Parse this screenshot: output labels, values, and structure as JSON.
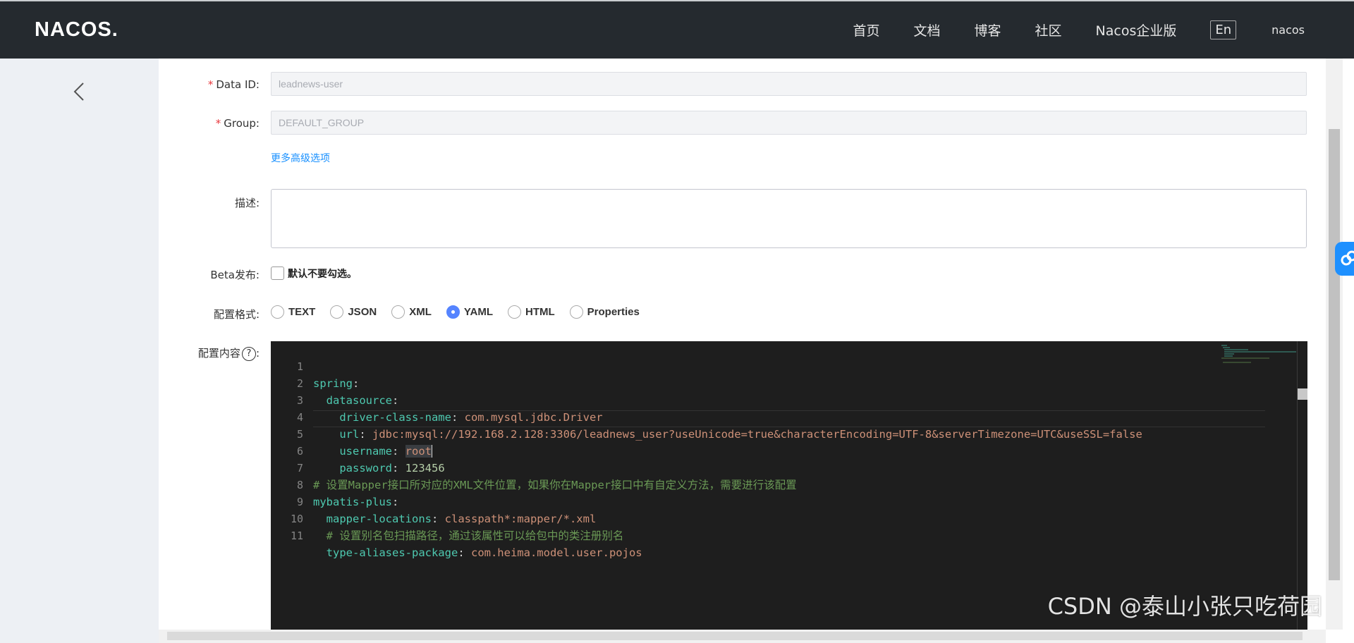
{
  "header": {
    "logo": "NACOS.",
    "nav": [
      "首页",
      "文档",
      "博客",
      "社区",
      "Nacos企业版"
    ],
    "lang": "En",
    "user": "nacos"
  },
  "form": {
    "data_id": {
      "label": "Data ID:",
      "value": "leadnews-user"
    },
    "group": {
      "label": "Group:",
      "value": "DEFAULT_GROUP"
    },
    "advanced_link": "更多高级选项",
    "description": {
      "label": "描述:",
      "value": ""
    },
    "beta": {
      "label": "Beta发布:",
      "checkbox_text": "默认不要勾选。",
      "checked": false
    },
    "format": {
      "label": "配置格式:",
      "options": [
        "TEXT",
        "JSON",
        "XML",
        "YAML",
        "HTML",
        "Properties"
      ],
      "selected": "YAML"
    },
    "content": {
      "label": "配置内容",
      "help": "?"
    }
  },
  "editor": {
    "lines": [
      {
        "num": "1",
        "text": "spring:"
      },
      {
        "num": "2",
        "text": "  datasource:"
      },
      {
        "num": "3",
        "text": "    driver-class-name: com.mysql.jdbc.Driver"
      },
      {
        "num": "4",
        "text": "    url: jdbc:mysql://192.168.2.128:3306/leadnews_user?useUnicode=true&characterEncoding=UTF-8&serverTimezone=UTC&useSSL=false"
      },
      {
        "num": "5",
        "text": "    username: root"
      },
      {
        "num": "6",
        "text": "    password: 123456"
      },
      {
        "num": "7",
        "text": "# 设置Mapper接口所对应的XML文件位置，如果你在Mapper接口中有自定义方法，需要进行该配置"
      },
      {
        "num": "8",
        "text": "mybatis-plus:"
      },
      {
        "num": "9",
        "text": "  mapper-locations: classpath*:mapper/*.xml"
      },
      {
        "num": "10",
        "text": "  # 设置别名包扫描路径，通过该属性可以给包中的类注册别名"
      },
      {
        "num": "11",
        "text": "  type-aliases-package: com.heima.model.user.pojos"
      }
    ]
  },
  "watermark": "CSDN @泰山小张只吃荷园",
  "colors": {
    "topbar": "#252a2f",
    "accent": "#5584ff",
    "link": "#1890ff",
    "required": "#e8383d"
  }
}
